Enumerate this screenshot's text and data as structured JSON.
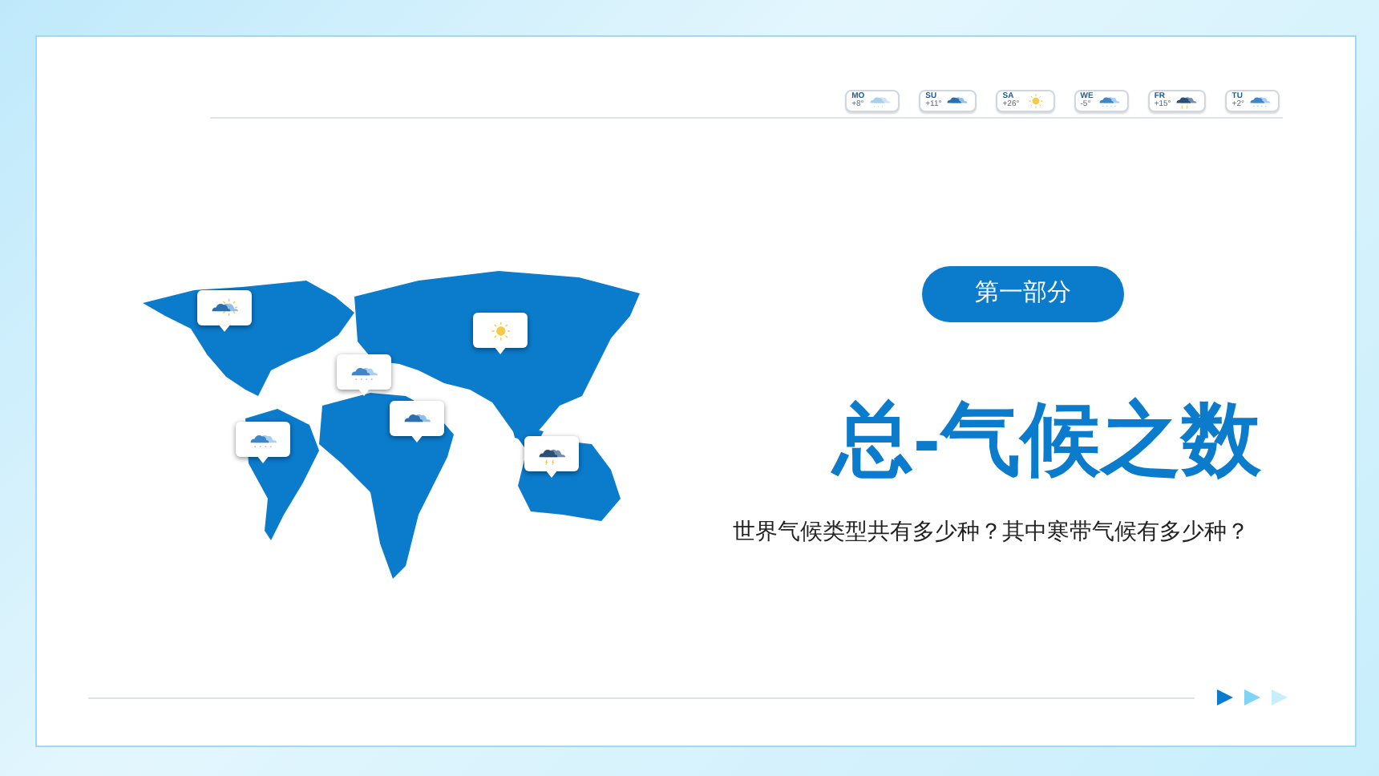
{
  "forecast": [
    {
      "day": "MO",
      "temp": "+8°",
      "kind": "cloud"
    },
    {
      "day": "SU",
      "temp": "+11°",
      "kind": "cloudy"
    },
    {
      "day": "SA",
      "temp": "+26°",
      "kind": "sun"
    },
    {
      "day": "WE",
      "temp": "-5°",
      "kind": "snow"
    },
    {
      "day": "FR",
      "temp": "+15°",
      "kind": "storm"
    },
    {
      "day": "TU",
      "temp": "+2°",
      "kind": "snow"
    }
  ],
  "section_badge": "第一部分",
  "title": "总-气候之数",
  "subtitle": "世界气候类型共有多少种？其中寒带气候有多少种？"
}
